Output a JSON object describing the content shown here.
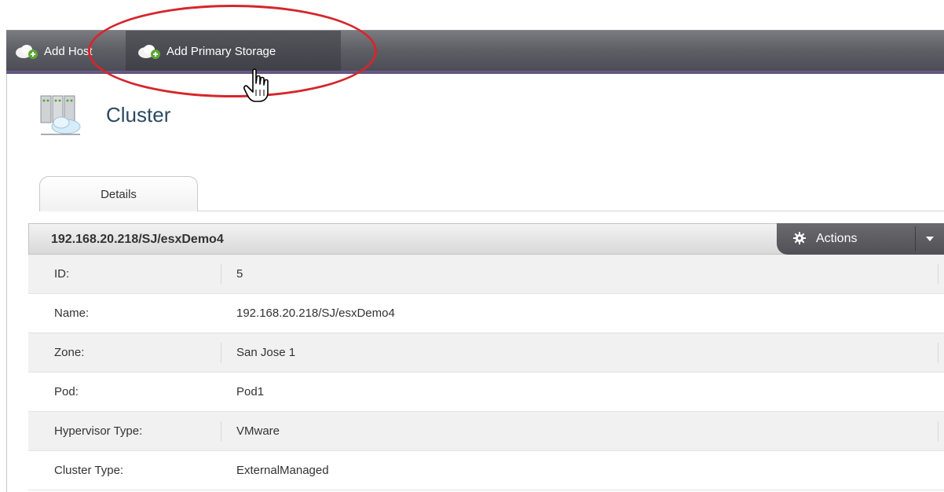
{
  "toolbar": {
    "add_host_label": "Add Host",
    "add_primary_storage_label": "Add Primary Storage"
  },
  "page": {
    "title": "Cluster"
  },
  "tabs": [
    {
      "label": "Details"
    }
  ],
  "panel": {
    "title": "192.168.20.218/SJ/esxDemo4",
    "actions_label": "Actions"
  },
  "details": [
    {
      "key": "ID:",
      "value": "5"
    },
    {
      "key": "Name:",
      "value": "192.168.20.218/SJ/esxDemo4"
    },
    {
      "key": "Zone:",
      "value": "San Jose 1"
    },
    {
      "key": "Pod:",
      "value": "Pod1"
    },
    {
      "key": "Hypervisor Type:",
      "value": "VMware"
    },
    {
      "key": "Cluster Type:",
      "value": "ExternalManaged"
    }
  ],
  "colors": {
    "toolbar": "#5e5f65",
    "annotation_ellipse": "#d6262b",
    "title": "#2c4a62",
    "add_badge": "#5aa832"
  },
  "icons": [
    "cloud-add-icon",
    "hand-cursor-icon",
    "cluster-icon",
    "gear-icon",
    "caret-down-icon"
  ]
}
